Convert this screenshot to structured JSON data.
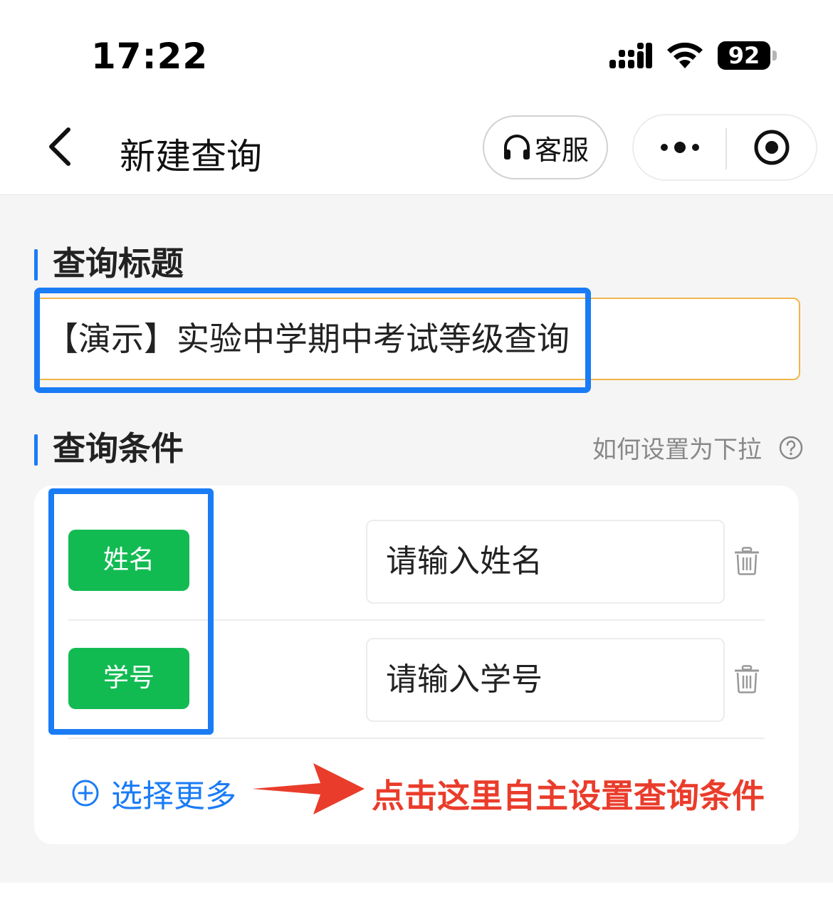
{
  "status_bar": {
    "time": "17:22",
    "battery": "92"
  },
  "nav": {
    "title": "新建查询",
    "service_label": "客服",
    "icons": {
      "back": "chevron-left-icon",
      "service": "headset-icon",
      "more": "more-dots-icon",
      "close": "target-close-icon"
    }
  },
  "query_title": {
    "heading": "查询标题",
    "value": "【演示】实验中学期中考试等级查询"
  },
  "conditions": {
    "heading": "查询条件",
    "help_text": "如何设置为下拉",
    "items": [
      {
        "tag": "姓名",
        "placeholder": "请输入姓名"
      },
      {
        "tag": "学号",
        "placeholder": "请输入学号"
      }
    ],
    "more_label": "选择更多",
    "annotation": "点击这里自主设置查询条件"
  },
  "colors": {
    "accent": "#1a7cf5",
    "tag_green": "#12bb52",
    "input_border": "#f2b54a",
    "annotation_red": "#ea3c2b"
  }
}
